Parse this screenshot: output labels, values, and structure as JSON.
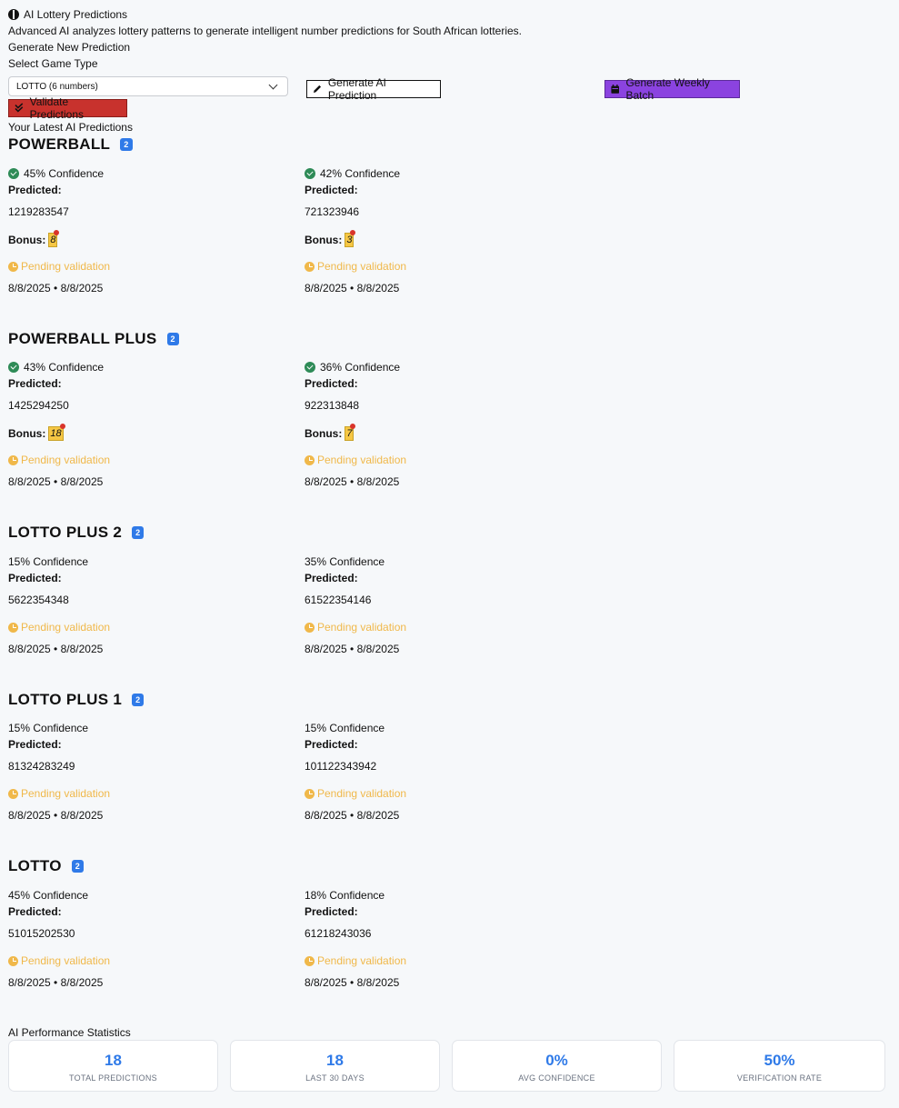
{
  "header": {
    "title": "AI Lottery Predictions",
    "description": "Advanced AI analyzes lottery patterns to generate intelligent number predictions for South African lotteries.",
    "section_label": "Generate New Prediction",
    "select_label": "Select Game Type",
    "select_value": "LOTTO (6 numbers)",
    "buttons": {
      "generate": "Generate AI Prediction",
      "weekly": "Generate Weekly Batch",
      "validate": "Validate Predictions"
    },
    "latest_label": "Your Latest AI Predictions"
  },
  "labels": {
    "predicted": "Predicted:",
    "bonus": "Bonus:"
  },
  "groups": [
    {
      "name": "POWERBALL",
      "count": "2",
      "cards": [
        {
          "confidence": "45% Confidence",
          "numbers": "1219283547",
          "bonus": "8",
          "status": "Pending validation",
          "dates": "8/8/2025 • 8/8/2025"
        },
        {
          "confidence": "42% Confidence",
          "numbers": "721323946",
          "bonus": "3",
          "status": "Pending validation",
          "dates": "8/8/2025 • 8/8/2025"
        }
      ]
    },
    {
      "name": "POWERBALL PLUS",
      "count": "2",
      "cards": [
        {
          "confidence": "43% Confidence",
          "numbers": "1425294250",
          "bonus": "18",
          "status": "Pending validation",
          "dates": "8/8/2025 • 8/8/2025"
        },
        {
          "confidence": "36% Confidence",
          "numbers": "922313848",
          "bonus": "7",
          "status": "Pending validation",
          "dates": "8/8/2025 • 8/8/2025"
        }
      ]
    },
    {
      "name": "LOTTO PLUS 2",
      "count": "2",
      "cards": [
        {
          "confidence": "15% Confidence",
          "numbers": "5622354348",
          "status": "Pending validation",
          "dates": "8/8/2025 • 8/8/2025"
        },
        {
          "confidence": "35% Confidence",
          "numbers": "61522354146",
          "status": "Pending validation",
          "dates": "8/8/2025 • 8/8/2025"
        }
      ]
    },
    {
      "name": "LOTTO PLUS 1",
      "count": "2",
      "cards": [
        {
          "confidence": "15% Confidence",
          "numbers": "81324283249",
          "status": "Pending validation",
          "dates": "8/8/2025 • 8/8/2025"
        },
        {
          "confidence": "15% Confidence",
          "numbers": "101122343942",
          "status": "Pending validation",
          "dates": "8/8/2025 • 8/8/2025"
        }
      ]
    },
    {
      "name": "LOTTO",
      "count": "2",
      "cards": [
        {
          "confidence": "45% Confidence",
          "numbers": "51015202530",
          "status": "Pending validation",
          "dates": "8/8/2025 • 8/8/2025"
        },
        {
          "confidence": "18% Confidence",
          "numbers": "61218243036",
          "status": "Pending validation",
          "dates": "8/8/2025 • 8/8/2025"
        }
      ]
    }
  ],
  "stats": {
    "title": "AI Performance Statistics",
    "items": [
      {
        "value": "18",
        "label": "TOTAL PREDICTIONS"
      },
      {
        "value": "18",
        "label": "LAST 30 DAYS"
      },
      {
        "value": "0%",
        "label": "AVG CONFIDENCE"
      },
      {
        "value": "50%",
        "label": "VERIFICATION RATE"
      }
    ]
  },
  "colors": {
    "accent": "#2f7ae8",
    "pending": "#f0b84a",
    "weekly_button": "#8b43e0",
    "validate_button": "#c8322d",
    "confidence_check": "#2e8b57"
  }
}
